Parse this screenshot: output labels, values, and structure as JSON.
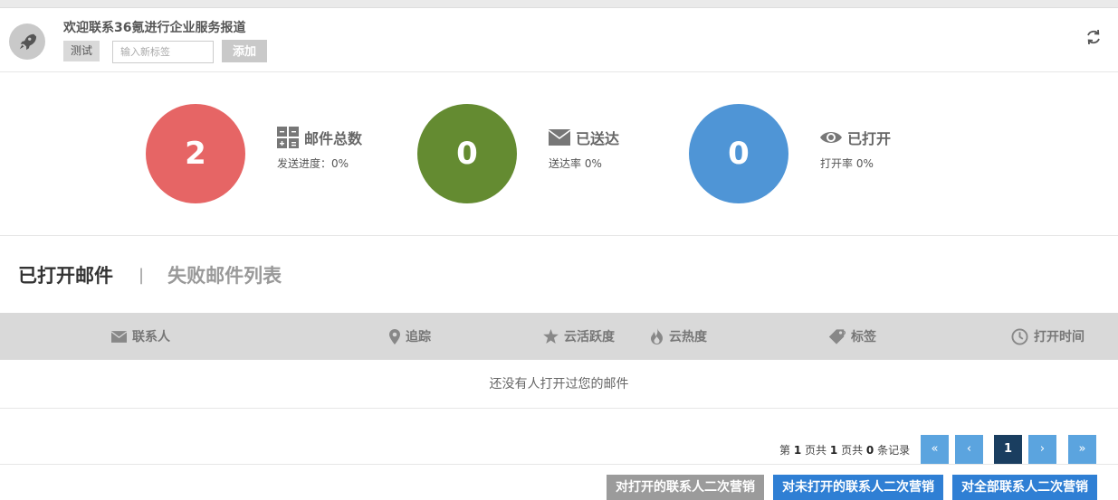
{
  "header": {
    "title": "欢迎联系36氪进行企业服务报道",
    "tag_label": "测试",
    "tag_input_placeholder": "输入新标签",
    "add_label": "添加"
  },
  "stats": [
    {
      "value": "2",
      "label": "邮件总数",
      "sub": "发送进度：0%",
      "color": "#e66565",
      "icon": "calculator-icon"
    },
    {
      "value": "0",
      "label": "已送达",
      "sub": "送达率 0%",
      "color": "#648b31",
      "icon": "envelope-icon"
    },
    {
      "value": "0",
      "label": "已打开",
      "sub": "打开率 0%",
      "color": "#4f95d6",
      "icon": "eye-icon"
    }
  ],
  "tabs": {
    "active": "已打开邮件",
    "separator": "|",
    "inactive": "失败邮件列表"
  },
  "table": {
    "columns": [
      {
        "label": "联系人",
        "icon": "envelope-icon"
      },
      {
        "label": "追踪",
        "icon": "map-marker-icon"
      },
      {
        "label": "云活跃度",
        "icon": "star-icon"
      },
      {
        "label": "云热度",
        "icon": "fire-icon"
      },
      {
        "label": "标签",
        "icon": "tags-icon"
      },
      {
        "label": "打开时间",
        "icon": "clock-icon"
      }
    ],
    "empty_message": "还没有人打开过您的邮件"
  },
  "pagination": {
    "prefix": "第",
    "page": "1",
    "mid1": "页共",
    "total_pages": "1",
    "mid2": "页共",
    "records": "0",
    "suffix": "条记录",
    "buttons": {
      "first": "«",
      "prev": "‹",
      "current": "1",
      "next": "›",
      "last": "»"
    }
  },
  "actions": [
    {
      "label": "对打开的联系人二次营销",
      "color": "#9b9b9b"
    },
    {
      "label": "对未打开的联系人二次营销",
      "color": "#2f7fd4"
    },
    {
      "label": "对全部联系人二次营销",
      "color": "#2f7fd4"
    }
  ]
}
